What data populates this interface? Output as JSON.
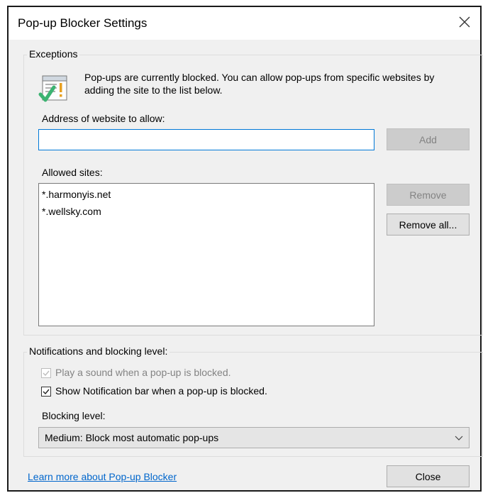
{
  "window": {
    "title": "Pop-up Blocker Settings",
    "close_glyph": "close-icon"
  },
  "exceptions": {
    "group_label": "Exceptions",
    "info_text": "Pop-ups are currently blocked.  You can allow pop-ups from specific websites by adding the site to the list below.",
    "address_label": "Address of website to allow:",
    "address_value": "",
    "add_label": "Add",
    "allowed_label": "Allowed sites:",
    "allowed_sites": [
      "*.harmonyis.net",
      "*.wellsky.com"
    ],
    "remove_label": "Remove",
    "remove_all_label": "Remove all..."
  },
  "notifications": {
    "group_label": "Notifications and blocking level:",
    "play_sound_label": "Play a sound when a pop-up is blocked.",
    "play_sound_checked": true,
    "play_sound_enabled": false,
    "show_bar_label": "Show Notification bar when a pop-up is blocked.",
    "show_bar_checked": true,
    "blocking_level_label": "Blocking level:",
    "blocking_level_value": "Medium: Block most automatic pop-ups"
  },
  "footer": {
    "learn_more": "Learn more about Pop-up Blocker",
    "close_label": "Close"
  },
  "colors": {
    "accent": "#0078d7",
    "link": "#0066cc",
    "check_green": "#3cb371",
    "warning_orange": "#e8a020"
  }
}
